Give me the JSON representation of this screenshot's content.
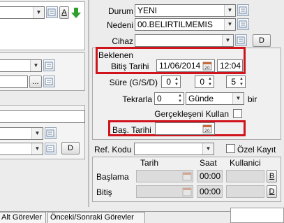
{
  "left": {
    "a_label": "A",
    "dots_label": "...",
    "d_label": "D"
  },
  "right": {
    "durum_label": "Durum",
    "durum_value": "YENI",
    "nedeni_label": "Nedeni",
    "nedeni_value": "00.BELIRTILMEMIS",
    "cihaz_label": "Cihaz",
    "cihaz_value": "",
    "cihaz_d_label": "D",
    "beklenen_label": "Beklenen",
    "bitis_tarihi_label": "Bitiş Tarihi",
    "bitis_tarihi_value": "11/06/2014",
    "bitis_saat_value": "12:04",
    "sure_label": "Süre (G/S/D)",
    "sure_g": "0",
    "sure_s": "0",
    "sure_d": "5",
    "tekrarla_label": "Tekrarla",
    "tekrarla_count": "0",
    "tekrarla_unit": "Günde",
    "bir_label": "bir",
    "gerceklesen_label": "Gerçekleşeni Kullan",
    "bas_tarihi_label": "Baş. Tarihi",
    "bas_tarihi_value": "",
    "ref_kodu_label": "Ref. Kodu",
    "ref_kodu_value": "",
    "ozel_kayit_label": "Özel Kayıt",
    "col_tarih": "Tarih",
    "col_saat": "Saat",
    "col_kullanici": "Kullanici",
    "baslama_label": "Başlama",
    "baslama_saat": "00:00",
    "bitis_label": "Bitiş",
    "bitis_saat": "00:00",
    "b_button": "B",
    "d_button": "D"
  },
  "tabs": [
    "Alt Görevler",
    "Önceki/Sonraki Görevler"
  ],
  "colors": {
    "accent_red": "#d0141c",
    "green_arrow": "#2e9e2e"
  }
}
